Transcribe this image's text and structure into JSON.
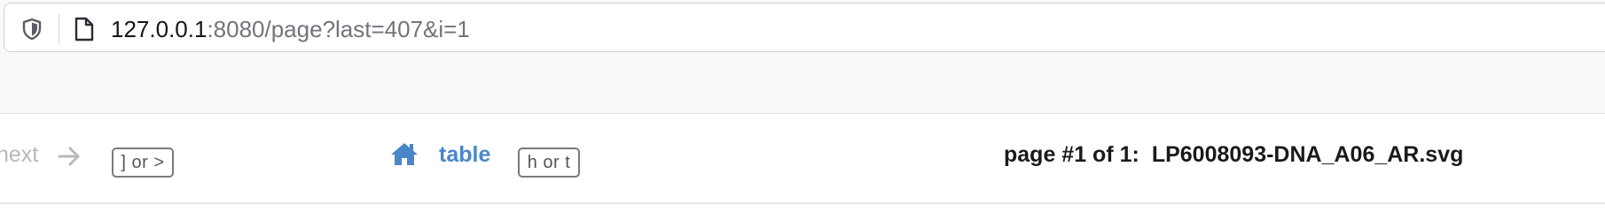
{
  "browser": {
    "url_host": "127.0.0.1",
    "url_rest": ":8080/page?last=407&i=1",
    "icons": [
      "shield-icon",
      "page-icon"
    ]
  },
  "nav": {
    "next_label": "next",
    "next_shortcut": "] or >",
    "table_label": "table",
    "table_shortcut": "h or t",
    "page_status": "page #1 of 1:",
    "filename": "LP6008093-DNA_A06_AR.svg",
    "icons": [
      "arrow-right-icon",
      "home-icon"
    ]
  },
  "colors": {
    "link": "#4a86c8",
    "disabled": "#b8b8b8",
    "text": "#1a1a1a"
  }
}
